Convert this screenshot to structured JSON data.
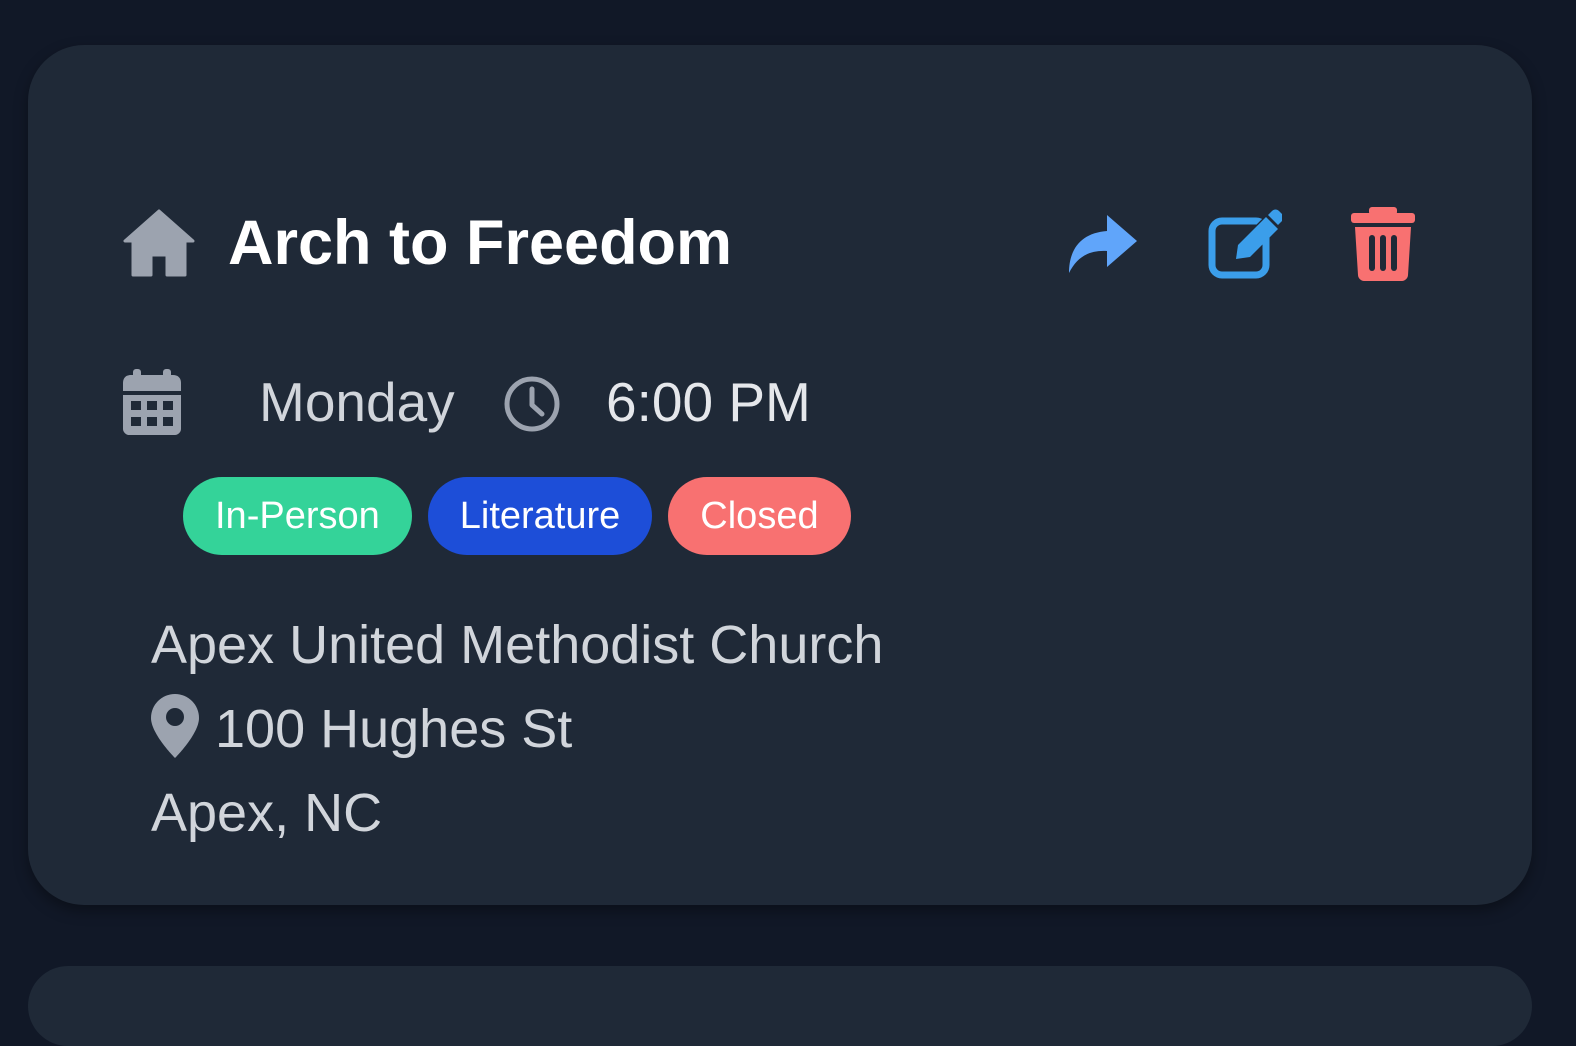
{
  "meeting": {
    "title": "Arch to Freedom",
    "day": "Monday",
    "time": "6:00 PM",
    "tags": [
      "In-Person",
      "Literature",
      "Closed"
    ],
    "location_name": "Apex United Methodist Church",
    "street": "100 Hughes St",
    "city": "Apex, NC"
  },
  "icons": {
    "title": "home-icon",
    "share": "share-icon",
    "edit": "edit-icon",
    "delete": "trash-icon",
    "day": "calendar-icon",
    "time": "clock-icon",
    "address": "map-pin-icon"
  },
  "colors": {
    "background": "#111827",
    "card": "#1f2937",
    "share": "#60a5fa",
    "edit": "#3b9eea",
    "delete": "#f87171",
    "tag_inperson": "#34d399",
    "tag_literature": "#1d4ed8",
    "tag_closed": "#f87171"
  }
}
